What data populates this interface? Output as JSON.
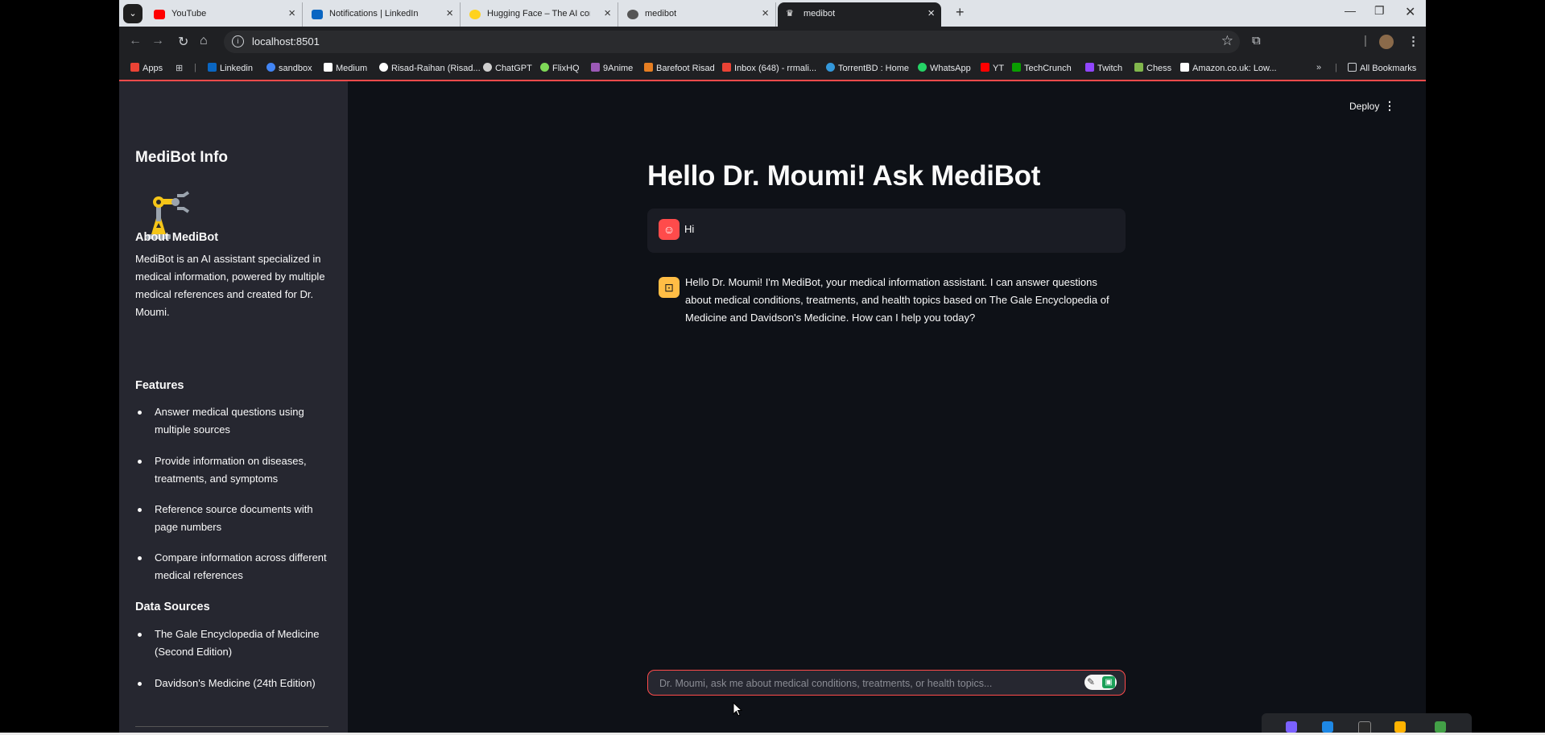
{
  "browser": {
    "tabs": [
      {
        "title": "YouTube",
        "color": "#ff0000"
      },
      {
        "title": "Notifications | LinkedIn",
        "color": "#0a66c2"
      },
      {
        "title": "Hugging Face – The AI commu",
        "color": "#ffd21e"
      },
      {
        "title": "medibot",
        "color": "#555555"
      },
      {
        "title": "medibot",
        "color": "#ffffff"
      }
    ],
    "active_tab_index": 4,
    "url": "localhost:8501",
    "bookmarks": [
      {
        "label": "Apps",
        "color": "#ea4335"
      },
      {
        "label": "Linkedin",
        "color": "#0a66c2"
      },
      {
        "label": "sandbox",
        "color": "#4285f4"
      },
      {
        "label": "Medium",
        "color": "#ffffff"
      },
      {
        "label": "Risad-Raihan (Risad...",
        "color": "#ffffff"
      },
      {
        "label": "ChatGPT",
        "color": "#cfcfcf"
      },
      {
        "label": "FlixHQ",
        "color": "#7ed957"
      },
      {
        "label": "9Anime",
        "color": "#9b59b6"
      },
      {
        "label": "Barefoot Risad",
        "color": "#e67e22"
      },
      {
        "label": "Inbox (648) - rrmali...",
        "color": "#ea4335"
      },
      {
        "label": "TorrentBD : Home",
        "color": "#3498db"
      },
      {
        "label": "WhatsApp",
        "color": "#25d366"
      },
      {
        "label": "YT",
        "color": "#ff0000"
      },
      {
        "label": "TechCrunch",
        "color": "#0a9e01"
      },
      {
        "label": "Twitch",
        "color": "#9146ff"
      },
      {
        "label": "Chess",
        "color": "#81b64c"
      },
      {
        "label": "Amazon.co.uk: Low...",
        "color": "#ffffff"
      }
    ],
    "all_bookmarks": "All Bookmarks"
  },
  "sidebar": {
    "title": "MediBot Info",
    "about_heading": "About MediBot",
    "about_text": "MediBot is an AI assistant specialized in medical information, powered by multiple medical references and created for Dr. Moumi.",
    "features_heading": "Features",
    "features": [
      "Answer medical questions using multiple sources",
      "Provide information on diseases, treatments, and symptoms",
      "Reference source documents with page numbers",
      "Compare information across different medical references"
    ],
    "sources_heading": "Data Sources",
    "sources": [
      "The Gale Encyclopedia of Medicine (Second Edition)",
      "Davidson's Medicine (24th Edition)"
    ]
  },
  "header": {
    "deploy_label": "Deploy"
  },
  "main": {
    "title": "Hello Dr. Moumi! Ask MediBot",
    "messages": [
      {
        "role": "user",
        "text": "Hi"
      },
      {
        "role": "assistant",
        "text": "Hello Dr. Moumi! I'm MediBot, your medical information assistant. I can answer questions about medical conditions, treatments, and health topics based on The Gale Encyclopedia of Medicine and Davidson's Medicine. How can I help you today?"
      }
    ],
    "input_placeholder": "Dr. Moumi, ask me about medical conditions, treatments, or health topics..."
  },
  "colors": {
    "accent": "#ff4b4b",
    "background": "#0e1117",
    "sidebar": "#262730",
    "assistant_avatar": "#ffbd45"
  }
}
